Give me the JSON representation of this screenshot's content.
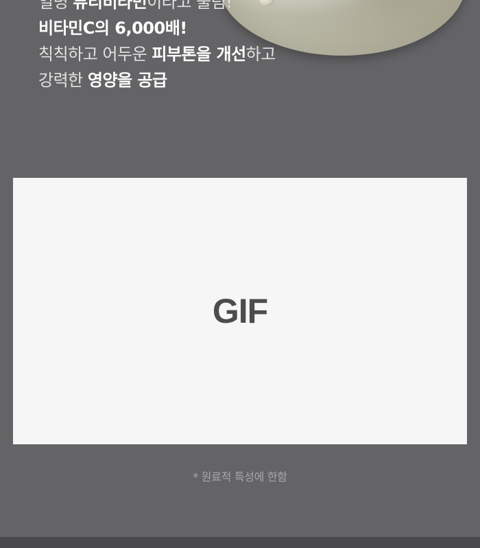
{
  "headline": {
    "line1": {
      "prefix": "일명 ",
      "strong": "뷰티비타민",
      "suffix": "이라고 불림!"
    },
    "line2": {
      "strong": "비타민C의 6,000배!"
    },
    "line3": {
      "prefix": "칙칙하고 어두운 ",
      "strong1": "피부톤을 개선",
      "suffix": "하고"
    },
    "line4": {
      "prefix": "강력한 ",
      "strong": "영양을 공급"
    }
  },
  "media": {
    "gif_label": "GIF"
  },
  "footnote": "* 원료적 특성에 한함"
}
